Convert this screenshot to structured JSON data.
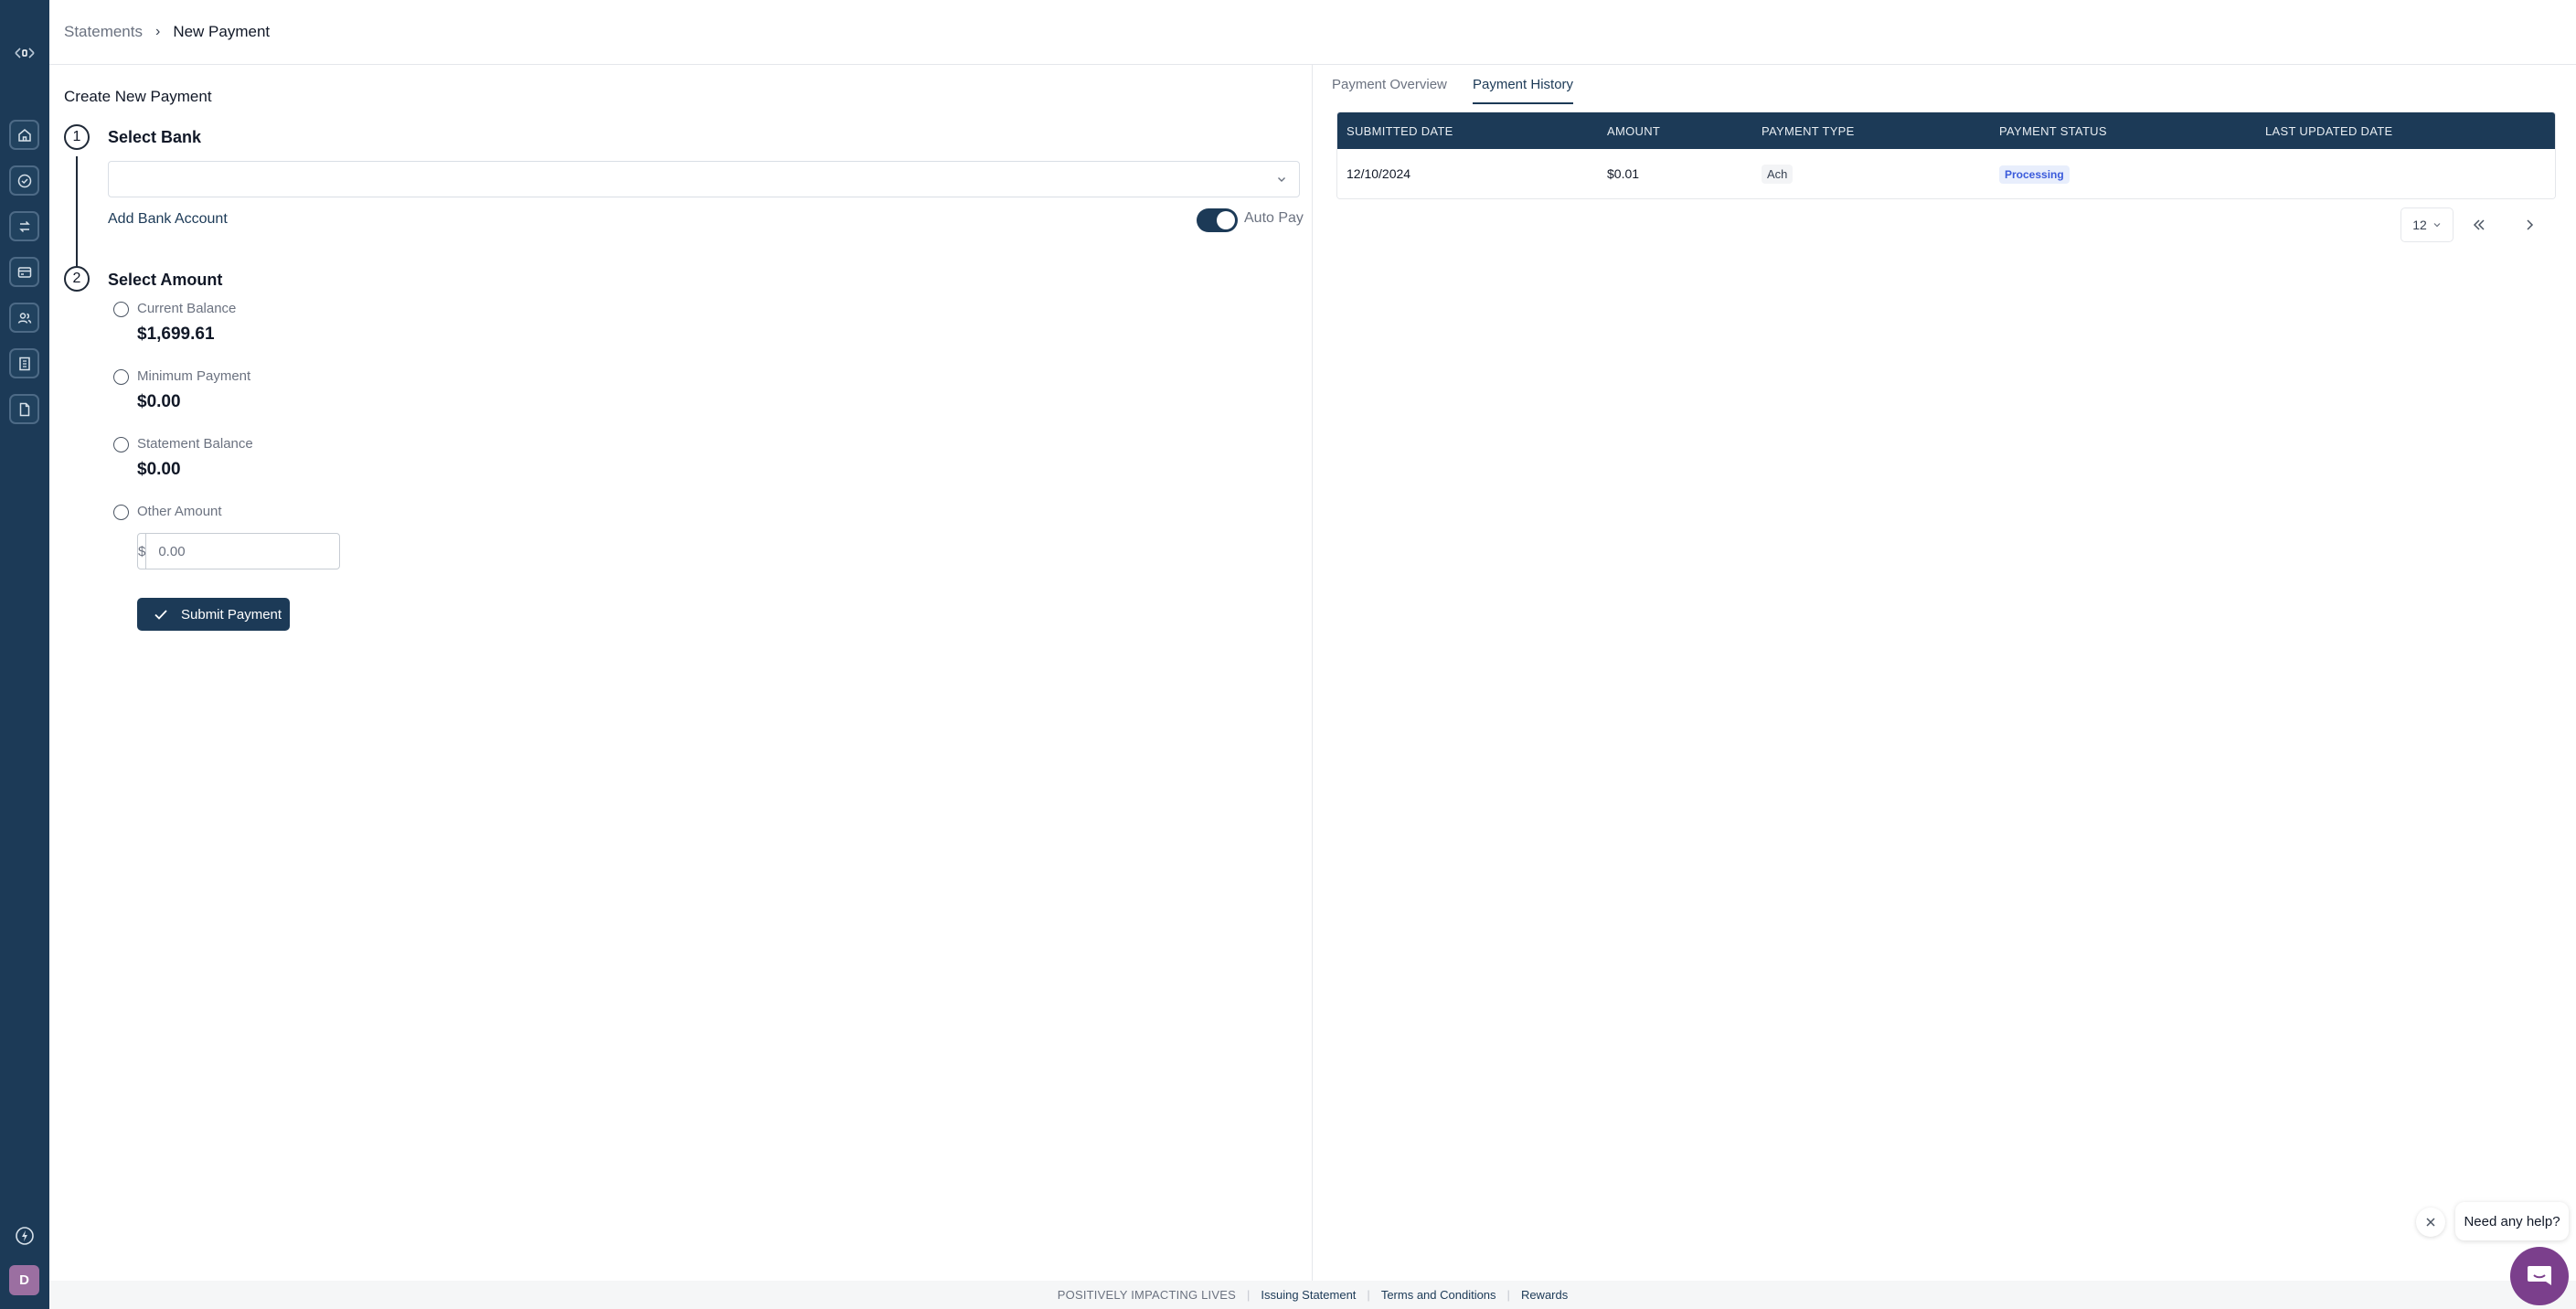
{
  "breadcrumb": {
    "parent": "Statements",
    "separator": "›",
    "current": "New Payment"
  },
  "sidebar": {
    "items": [
      {
        "icon": "home-icon"
      },
      {
        "icon": "check-circle-icon"
      },
      {
        "icon": "transfer-icon"
      },
      {
        "icon": "card-icon"
      },
      {
        "icon": "users-icon"
      },
      {
        "icon": "building-icon"
      },
      {
        "icon": "document-icon"
      }
    ],
    "avatar_initial": "D"
  },
  "form": {
    "title": "Create New Payment",
    "step1": {
      "number": "1",
      "label": "Select Bank",
      "bank_value": ""
    },
    "add_bank_label": "Add Bank Account",
    "autopay_label": "Auto Pay",
    "autopay_on": true,
    "step2": {
      "number": "2",
      "label": "Select Amount"
    },
    "options": [
      {
        "label": "Current Balance",
        "value": "$1,699.61"
      },
      {
        "label": "Minimum Payment",
        "value": "$0.00"
      },
      {
        "label": "Statement Balance",
        "value": "$0.00"
      },
      {
        "label": "Other Amount"
      }
    ],
    "other_amount": {
      "prefix": "$",
      "placeholder": "0.00"
    },
    "submit_label": "Submit Payment"
  },
  "tabs": [
    {
      "label": "Payment Overview",
      "active": false
    },
    {
      "label": "Payment History",
      "active": true
    }
  ],
  "table": {
    "columns": [
      "SUBMITTED DATE",
      "AMOUNT",
      "PAYMENT TYPE",
      "PAYMENT STATUS",
      "LAST UPDATED DATE"
    ],
    "rows": [
      {
        "submitted_date": "12/10/2024",
        "amount": "$0.01",
        "payment_type": "Ach",
        "payment_status": "Processing",
        "last_updated_date": ""
      }
    ]
  },
  "pagination": {
    "page_size": "12"
  },
  "footer": {
    "tagline": "POSITIVELY IMPACTING LIVES",
    "links": [
      "Issuing Statement",
      "Terms and Conditions",
      "Rewards"
    ]
  },
  "help": {
    "bubble_text": "Need any help?"
  },
  "colors": {
    "primary": "#1c3a57",
    "status_text": "#3b5bdb",
    "status_bg": "#e8eefc",
    "chat": "#7b3f8c",
    "avatar": "#9b6fa1"
  }
}
